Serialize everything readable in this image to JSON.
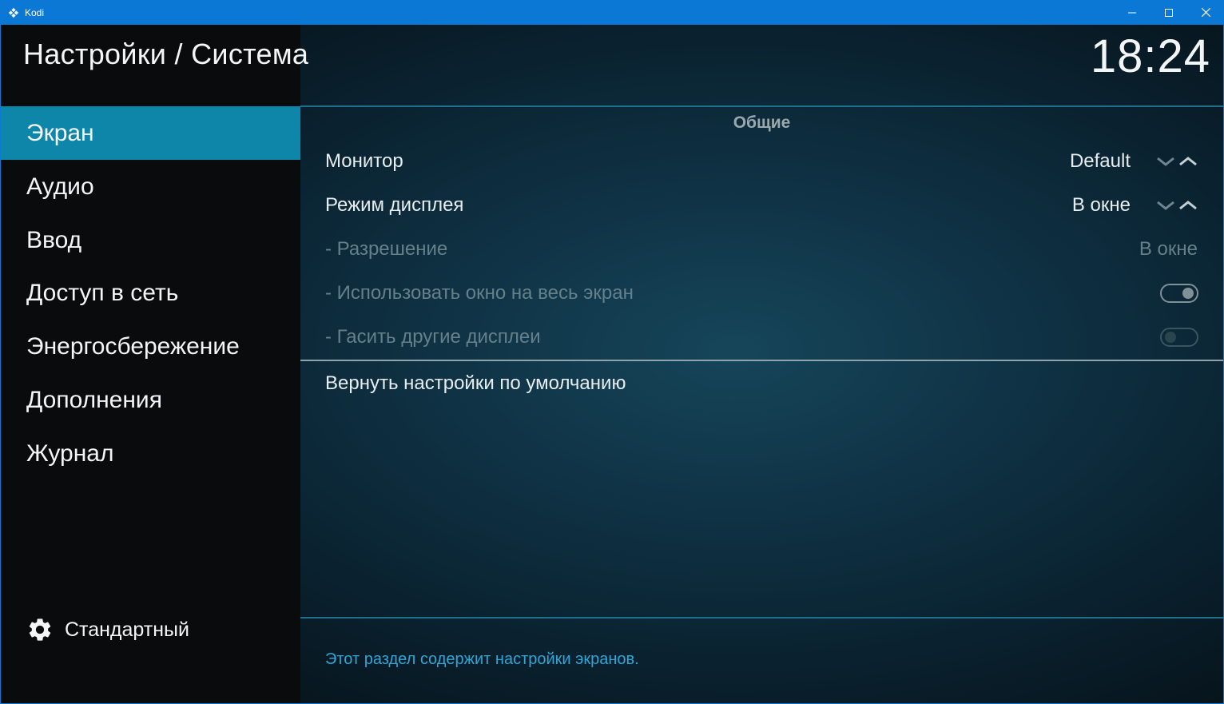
{
  "window": {
    "title": "Kodi",
    "accent": "#0a78d4",
    "controls": [
      "minimize-icon",
      "maximize-icon",
      "close-icon"
    ]
  },
  "header": {
    "title": "Настройки / Система",
    "clock": "18:24"
  },
  "sidebar": {
    "items": [
      {
        "label": "Экран",
        "active": true
      },
      {
        "label": "Аудио"
      },
      {
        "label": "Ввод"
      },
      {
        "label": "Доступ в сеть"
      },
      {
        "label": "Энергосбережение"
      },
      {
        "label": "Дополнения"
      },
      {
        "label": "Журнал"
      }
    ],
    "footer": {
      "icon": "gear-icon",
      "label": "Стандартный"
    },
    "active_color": "#0e86a9"
  },
  "main": {
    "section_title": "Общие",
    "settings": [
      {
        "label": "Монитор",
        "value": "Default",
        "control": "spinner",
        "enabled": true
      },
      {
        "label": "Режим дисплея",
        "value": "В окне",
        "control": "spinner",
        "enabled": true
      },
      {
        "label": "- Разрешение",
        "value": "В окне",
        "control": "text",
        "enabled": false
      },
      {
        "label": "- Использовать окно на весь экран",
        "control": "toggle",
        "state": "on",
        "enabled": false
      },
      {
        "label": "- Гасить другие дисплеи",
        "control": "toggle",
        "state": "off",
        "enabled": false
      }
    ],
    "reset_label": "Вернуть настройки по умолчанию",
    "description": "Этот раздел содержит настройки экранов.",
    "description_color": "#2fa6d6"
  }
}
